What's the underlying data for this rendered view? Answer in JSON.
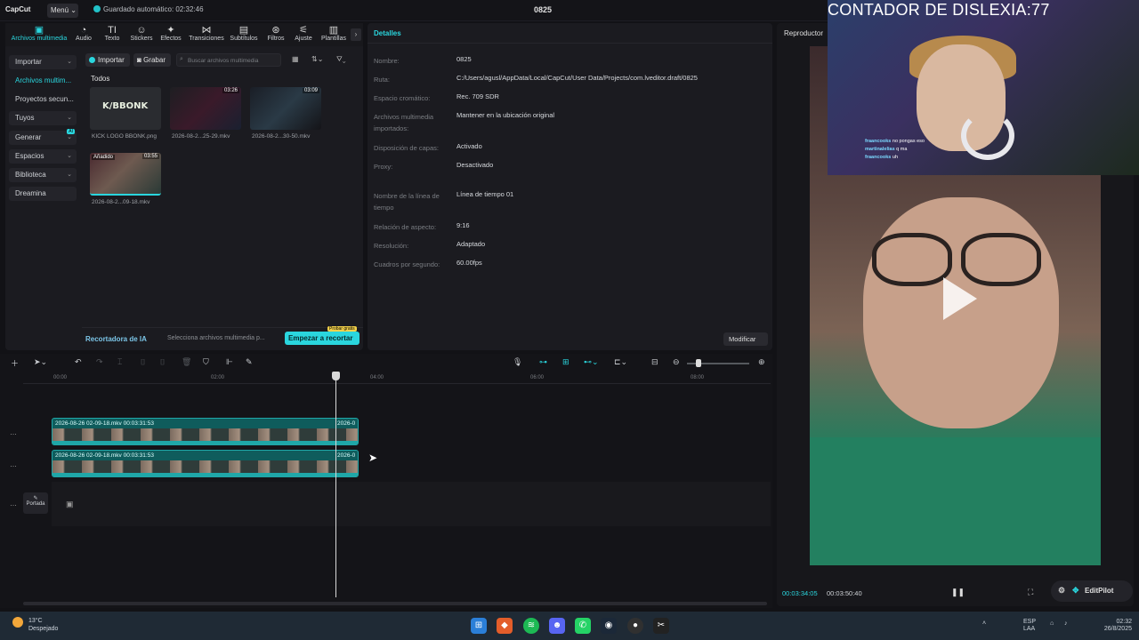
{
  "titlebar": {
    "logo": "CapCut",
    "menu": "Menú",
    "autosave": "Guardado automático: 02:32:46",
    "project": "0825"
  },
  "tools": [
    {
      "label": "Archivos multimedia",
      "icon": "media-icon",
      "glyph": "▣",
      "active": true
    },
    {
      "label": "Audio",
      "icon": "audio-icon",
      "glyph": "◔"
    },
    {
      "label": "Texto",
      "icon": "text-icon",
      "glyph": "TI"
    },
    {
      "label": "Stickers",
      "icon": "sticker-icon",
      "glyph": "☺"
    },
    {
      "label": "Efectos",
      "icon": "effects-icon",
      "glyph": "✦"
    },
    {
      "label": "Transiciones",
      "icon": "transition-icon",
      "glyph": "⋈"
    },
    {
      "label": "Subtítulos",
      "icon": "subtitles-icon",
      "glyph": "▤"
    },
    {
      "label": "Filtros",
      "icon": "filters-icon",
      "glyph": "⊛"
    },
    {
      "label": "Ajuste",
      "icon": "adjust-icon",
      "glyph": "⚟"
    },
    {
      "label": "Plantillas",
      "icon": "templates-icon",
      "glyph": "▥"
    }
  ],
  "sidenav": {
    "import": "Importar",
    "media": "Archivos multim...",
    "secondary": "Proyectos secun...",
    "yours": "Tuyos",
    "generate": "Generar",
    "spaces": "Espacios",
    "library": "Biblioteca",
    "dreamina": "Dreamina"
  },
  "media": {
    "import_btn": "Importar",
    "record_btn": "Grabar",
    "search_placeholder": "Buscar archivos multimedia",
    "all": "Todos",
    "items": [
      {
        "name": "KICK LOGO BBONK.png",
        "duration": "",
        "added": ""
      },
      {
        "name": "2026-08-2...25-29.mkv",
        "duration": "03:26",
        "added": ""
      },
      {
        "name": "2026-08-2...30-50.mkv",
        "duration": "03:09",
        "added": ""
      },
      {
        "name": "2026-08-2...09-18.mkv",
        "duration": "03:55",
        "added": "Añadido"
      }
    ],
    "logo_text": "K/BBONK"
  },
  "ai": {
    "title": "Recortadora de IA",
    "subtitle": "Selecciona archivos multimedia p...",
    "button": "Empezar a recortar",
    "badge": "Probar gratis"
  },
  "details": {
    "title": "Detalles",
    "rows": [
      {
        "k": "Nombre:",
        "v": "0825"
      },
      {
        "k": "Ruta:",
        "v": "C:/Users/agusl/AppData/Local/CapCut/User Data/Projects/com.lveditor.draft/0825"
      },
      {
        "k": "Espacio cromático:",
        "v": "Rec. 709 SDR"
      },
      {
        "k": "Archivos multimedia importados:",
        "v": "Mantener en la ubicación original"
      },
      {
        "k": "Disposición de capas:",
        "v": "Activado"
      },
      {
        "k": "Proxy:",
        "v": "Desactivado"
      },
      {
        "k": "Nombre de la línea de tiempo",
        "v": "Línea de tiempo 01"
      },
      {
        "k": "Relación de aspecto:",
        "v": "9:16"
      },
      {
        "k": "Resolución:",
        "v": "Adaptado"
      },
      {
        "k": "Cuadros por segundo:",
        "v": "60.00fps"
      }
    ],
    "modify": "Modificar"
  },
  "player": {
    "title": "Reproductor",
    "current": "00:03:34:05",
    "total": "00:03:50:40",
    "editpilot": "EditPilot"
  },
  "webcam": {
    "counter": "CONTADOR DE DISLEXIA:77",
    "chat": [
      {
        "user": "fraancooks",
        "msg": "no pongas eso"
      },
      {
        "user": "martinalelias",
        "msg": "q ma"
      },
      {
        "user": "fraancooks",
        "msg": "uh"
      }
    ]
  },
  "timeline": {
    "ticks": [
      "00:00",
      "02:00",
      "04:00",
      "06:00",
      "08:00"
    ],
    "clip1": {
      "label": "2026-08-26 02-09-18.mkv  00:03:31:53",
      "tail": "2026-0"
    },
    "clip2": {
      "label": "2026-08-26 02-09-18.mkv  00:03:31:53",
      "tail": "2026-0"
    },
    "cover": "Portada"
  },
  "taskbar": {
    "temp": "13°C",
    "weather": "Despejado",
    "lang1": "ESP",
    "lang2": "LAA",
    "time": "02:32",
    "date": "26/8/2025"
  },
  "colors": {
    "accent": "#2ad6de",
    "background": "#121216",
    "panel": "#1b1b20"
  }
}
